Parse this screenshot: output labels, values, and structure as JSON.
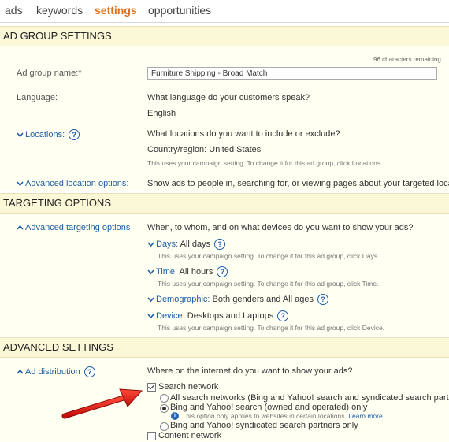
{
  "tabs": [
    "ads",
    "keywords",
    "settings",
    "opportunities"
  ],
  "sections": {
    "ad_group": "AD GROUP SETTINGS",
    "targeting": "TARGETING OPTIONS",
    "advanced": "ADVANCED SETTINGS"
  },
  "ad_group": {
    "char_remaining": "96 characters remaining",
    "name_label": "Ad group name:*",
    "name_value": "Furniture Shipping - Broad Match",
    "language_label": "Language:",
    "language_question": "What language do your customers speak?",
    "language_value": "English",
    "locations_label": "Locations:",
    "locations_question": "What locations do you want to include or exclude?",
    "locations_value": "Country/region: United States",
    "locations_hint": "This uses your campaign setting. To change it for this ad group, click Locations.",
    "adv_location_label": "Advanced location options:",
    "adv_location_text": "Show ads to people in, searching for, or viewing pages about your targeted location"
  },
  "targeting": {
    "adv_targeting_label": "Advanced targeting options",
    "question": "When, to whom, and on what devices do you want to show your ads?",
    "days_label": "Days:",
    "days_value": "All days",
    "days_hint": "This uses your campaign setting. To change it for this ad group, click Days.",
    "time_label": "Time:",
    "time_value": "All hours",
    "time_hint": "This uses your campaign setting. To change it for this ad group, click Time.",
    "demographic_label": "Demographic:",
    "demographic_value": "Both genders and All ages",
    "device_label": "Device:",
    "device_value": "Desktops and Laptops",
    "device_hint": "This uses your campaign setting. To change it for this ad group, click Device."
  },
  "advanced": {
    "ad_distribution_label": "Ad distribution",
    "question": "Where on the internet do you want to show your ads?",
    "search_network": "Search network",
    "opt_all": "All search networks (Bing and Yahoo! search and syndicated search partners)",
    "opt_owned": "Bing and Yahoo! search (owned and operated) only",
    "opt_owned_note": "This option only applies to websites in certain locations.",
    "learn_more": "Learn more",
    "opt_syndicated": "Bing and Yahoo! syndicated search partners only",
    "content_network": "Content network"
  },
  "help_symbol": "?",
  "info_symbol": "i"
}
